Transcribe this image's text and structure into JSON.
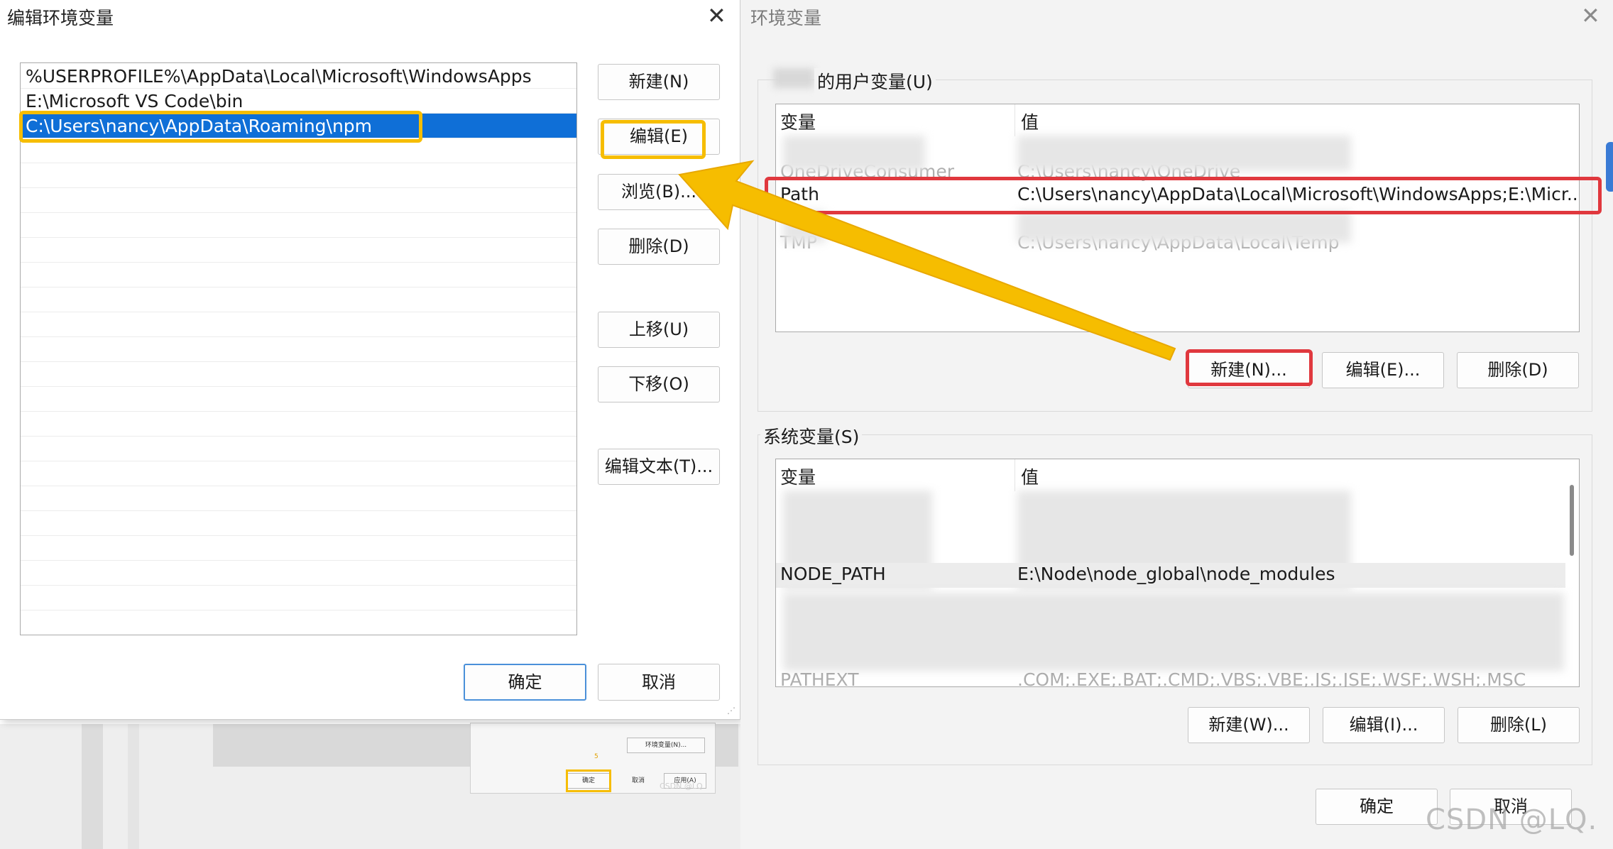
{
  "background_dialog": {
    "env_button": "环境变量(N)...",
    "number": "5",
    "ok": "确定",
    "cancel": "取消",
    "apply": "应用(A)",
    "watermark": "CSDN @LQ"
  },
  "edit_dialog": {
    "title": "编辑环境变量",
    "close_icon": "close-icon",
    "entries": [
      "%USERPROFILE%\\AppData\\Local\\Microsoft\\WindowsApps",
      "E:\\Microsoft VS Code\\bin",
      "C:\\Users\\nancy\\AppData\\Roaming\\npm"
    ],
    "selected_index": 2,
    "buttons": {
      "new": "新建(N)",
      "edit": "编辑(E)",
      "browse": "浏览(B)...",
      "delete": "删除(D)",
      "move_up": "上移(U)",
      "move_down": "下移(O)",
      "edit_text": "编辑文本(T)..."
    },
    "ok": "确定",
    "cancel": "取消"
  },
  "env_dialog": {
    "title": "环境变量",
    "user_group_label": "的用户变量(U)",
    "user_table": {
      "headers": [
        "变量",
        "值"
      ],
      "rows": [
        {
          "name": "OneDriveConsumer",
          "value": "C:\\Users\\nancy\\OneDrive"
        },
        {
          "name": "Path",
          "value": "C:\\Users\\nancy\\AppData\\Local\\Microsoft\\WindowsApps;E:\\Micr..."
        },
        {
          "name": "TMP",
          "value": "C:\\Users\\nancy\\AppData\\Local\\Temp"
        }
      ]
    },
    "user_buttons": {
      "new": "新建(N)...",
      "edit": "编辑(E)...",
      "delete": "删除(D)"
    },
    "system_group_label": "系统变量(S)",
    "system_table": {
      "headers": [
        "变量",
        "值"
      ],
      "rows": [
        {
          "name": "NODE_PATH",
          "value": "E:\\Node\\node_global\\node_modules"
        },
        {
          "name": "PATHEXT",
          "value": ".COM;.EXE;.BAT;.CMD;.VBS;.VBE;.JS;.JSE;.WSF;.WSH;.MSC"
        }
      ]
    },
    "system_buttons": {
      "new": "新建(W)...",
      "edit": "编辑(I)...",
      "delete": "删除(L)"
    },
    "ok": "确定",
    "cancel": "取消"
  },
  "watermark": "CSDN @LQ.",
  "colors": {
    "selection": "#0f6fd7",
    "highlight_yellow": "#f6bd00",
    "highlight_red": "#e0383e",
    "arrow": "#f6bd00"
  }
}
